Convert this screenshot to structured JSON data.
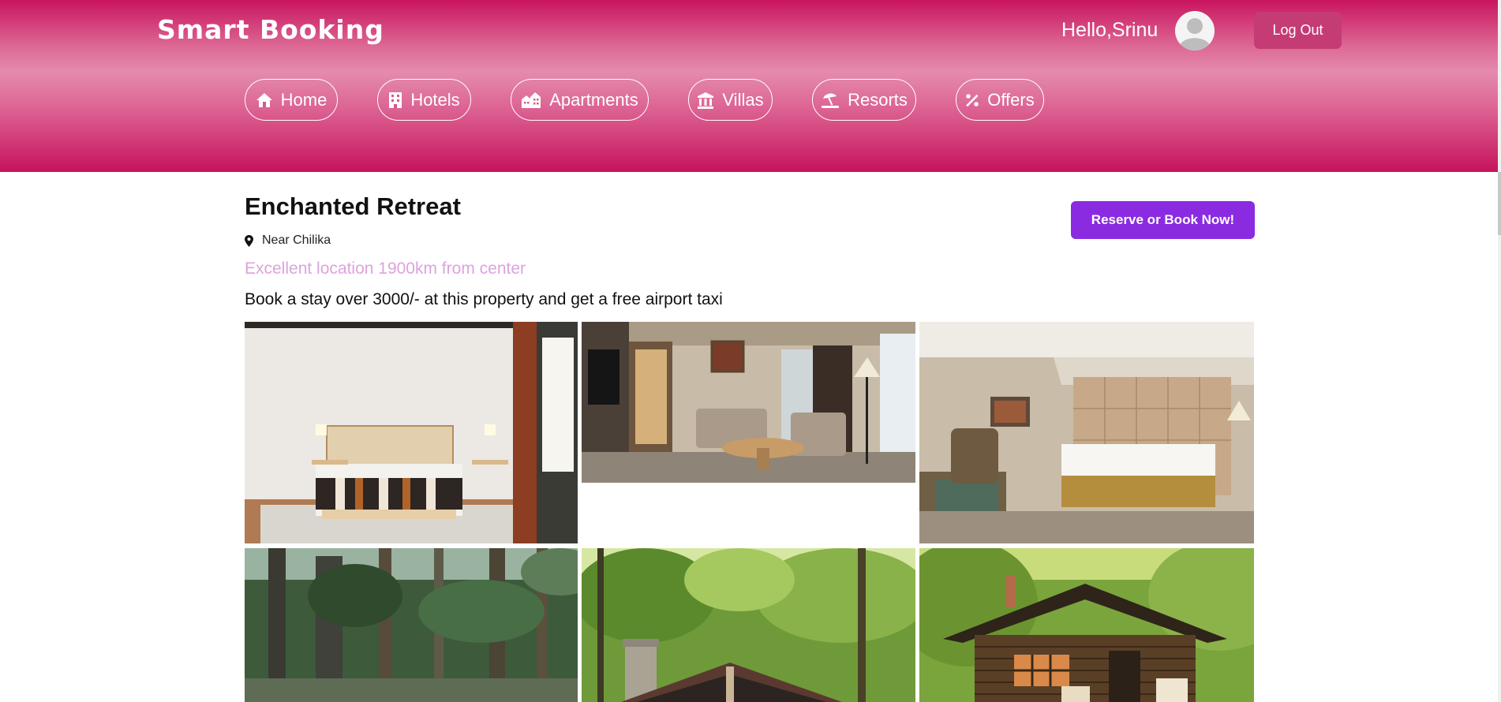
{
  "header": {
    "brand": "Smart Booking",
    "greeting": "Hello,Srinu",
    "logout_label": "Log Out",
    "nav": [
      {
        "label": "Home",
        "icon": "home-icon"
      },
      {
        "label": "Hotels",
        "icon": "building-icon"
      },
      {
        "label": "Apartments",
        "icon": "apartments-icon"
      },
      {
        "label": "Villas",
        "icon": "landmark-icon"
      },
      {
        "label": "Resorts",
        "icon": "umbrella-beach-icon"
      },
      {
        "label": "Offers",
        "icon": "percent-icon"
      }
    ]
  },
  "property": {
    "name": "Enchanted Retreat",
    "location": "Near Chilika",
    "distance_note": "Excellent location 1900km from center",
    "promo": "Book a stay over 3000/- at this property and get a free airport taxi",
    "reserve_label": "Reserve or Book Now!"
  },
  "gallery": [
    {
      "subject": "bedroom"
    },
    {
      "subject": "living-room"
    },
    {
      "subject": "hotel-room"
    },
    {
      "subject": "forest"
    },
    {
      "subject": "forest-cabin"
    },
    {
      "subject": "log-cabin"
    }
  ],
  "colors": {
    "header_pink": "#c9155e",
    "reserve_purple": "#8a2be2",
    "distance_text": "#dca3dd",
    "logout_bg": "#c53c74"
  }
}
